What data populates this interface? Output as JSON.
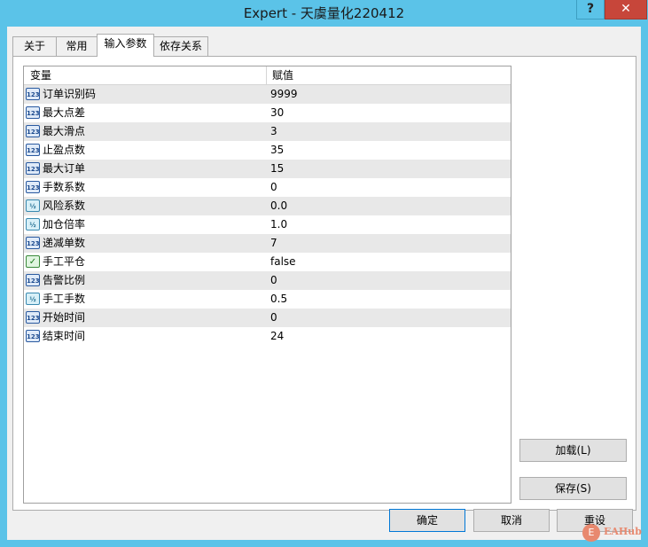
{
  "window": {
    "title": "Expert - 天虞量化220412",
    "help_label": "?",
    "close_label": "✕"
  },
  "tabs": [
    {
      "label": "关于"
    },
    {
      "label": "常用"
    },
    {
      "label": "输入参数"
    },
    {
      "label": "依存关系"
    }
  ],
  "active_tab": "输入参数",
  "grid": {
    "col_variable": "变量",
    "col_value": "赋值",
    "rows": [
      {
        "name": "订单识别码",
        "value": "9999",
        "icon": "int-icon",
        "icon_text": "123"
      },
      {
        "name": "最大点差",
        "value": "30",
        "icon": "int-icon",
        "icon_text": "123"
      },
      {
        "name": "最大滑点",
        "value": "3",
        "icon": "int-icon",
        "icon_text": "123"
      },
      {
        "name": "止盈点数",
        "value": "35",
        "icon": "int-icon",
        "icon_text": "123"
      },
      {
        "name": "最大订单",
        "value": "15",
        "icon": "int-icon",
        "icon_text": "123"
      },
      {
        "name": "手数系数",
        "value": "0",
        "icon": "int-icon",
        "icon_text": "123"
      },
      {
        "name": "风险系数",
        "value": "0.0",
        "icon": "double-icon",
        "icon_text": "½"
      },
      {
        "name": "加仓倍率",
        "value": "1.0",
        "icon": "double-icon",
        "icon_text": "½"
      },
      {
        "name": "递减单数",
        "value": "7",
        "icon": "int-icon",
        "icon_text": "123"
      },
      {
        "name": "手工平仓",
        "value": "false",
        "icon": "bool-icon",
        "icon_text": "✓"
      },
      {
        "name": "告警比例",
        "value": "0",
        "icon": "int-icon",
        "icon_text": "123"
      },
      {
        "name": "手工手数",
        "value": "0.5",
        "icon": "double-icon",
        "icon_text": "½"
      },
      {
        "name": "开始时间",
        "value": "0",
        "icon": "int-icon",
        "icon_text": "123"
      },
      {
        "name": "结束时间",
        "value": "24",
        "icon": "int-icon",
        "icon_text": "123"
      }
    ]
  },
  "side_buttons": {
    "load": "加载(L)",
    "save": "保存(S)"
  },
  "footer_buttons": {
    "ok": "确定",
    "cancel": "取消",
    "reset": "重设"
  },
  "watermark": {
    "logo": "E",
    "text": "EAHub"
  }
}
